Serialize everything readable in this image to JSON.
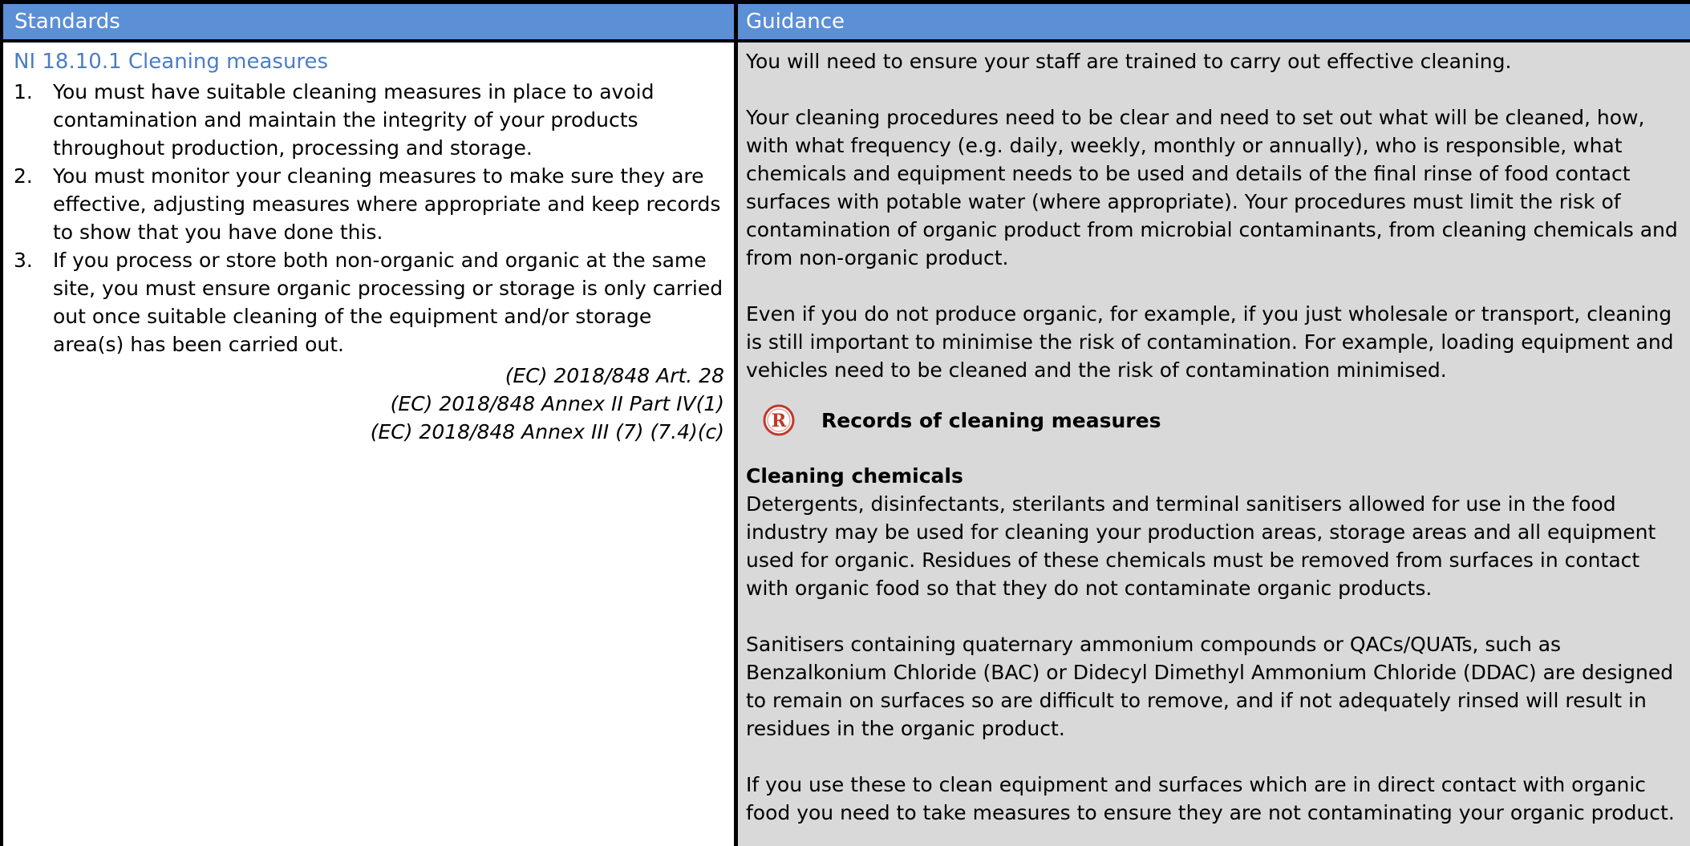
{
  "headers": {
    "standards": "Standards",
    "guidance": "Guidance"
  },
  "standards": {
    "title": "NI 18.10.1 Cleaning measures",
    "items": [
      {
        "num": "1.",
        "text": "You must have suitable cleaning measures in place to avoid contamination and maintain the integrity of your products throughout production, processing and storage."
      },
      {
        "num": "2.",
        "text": "You must monitor your cleaning measures to make sure they are effective, adjusting measures where appropriate and keep records to show that you have done this."
      },
      {
        "num": "3.",
        "text": "If you process or store both non-organic and organic at the same site, you must ensure organic processing or storage is only carried out once suitable cleaning of the equipment and/or storage area(s) has been carried out."
      }
    ],
    "references": [
      "(EC) 2018/848 Art. 28",
      "(EC) 2018/848 Annex II Part IV(1)",
      "(EC) 2018/848 Annex III (7) (7.4)(c)"
    ]
  },
  "guidance": {
    "para1": "You will need to ensure your staff are trained to carry out effective cleaning.",
    "para2": "Your cleaning procedures need to be clear and need to set out what will be cleaned, how, with what frequency (e.g. daily, weekly, monthly or annually), who is responsible, what chemicals and equipment needs to be used and details of the final rinse of food contact surfaces with potable water (where appropriate). Your procedures must limit the risk of contamination of organic product from microbial contaminants, from cleaning chemicals and from non-organic product.",
    "para3": "Even if you do not produce organic, for example, if you just wholesale or transport, cleaning is still important to minimise the risk of contamination. For example, loading equipment and vehicles need to be cleaned and the risk of contamination minimised.",
    "records_icon": "records-r-icon",
    "records_icon_letter": "R",
    "records_label": "Records of cleaning measures",
    "chemicals_heading": "Cleaning chemicals",
    "para4": "Detergents, disinfectants, sterilants and terminal sanitisers allowed for use in the food industry may be used for cleaning your production areas, storage areas and all equipment used for organic. Residues of these chemicals must be removed from surfaces in contact with organic food so that they do not contaminate organic products.",
    "para5": "Sanitisers containing quaternary ammonium compounds or QACs/QUATs, such as Benzalkonium Chloride (BAC) or Didecyl Dimethyl Ammonium Chloride (DDAC) are designed to remain on surfaces so are difficult to remove, and if not adequately rinsed will result in residues in the organic product.",
    "para6": "If you use these to clean equipment and surfaces which are in direct contact with organic food you need to take measures to ensure they are not contaminating your organic product."
  },
  "colors": {
    "header_bg": "#5b8fd6",
    "title_blue": "#4a7ec6",
    "guidance_bg": "#d9d9d9",
    "records_icon_red": "#c0392b"
  }
}
